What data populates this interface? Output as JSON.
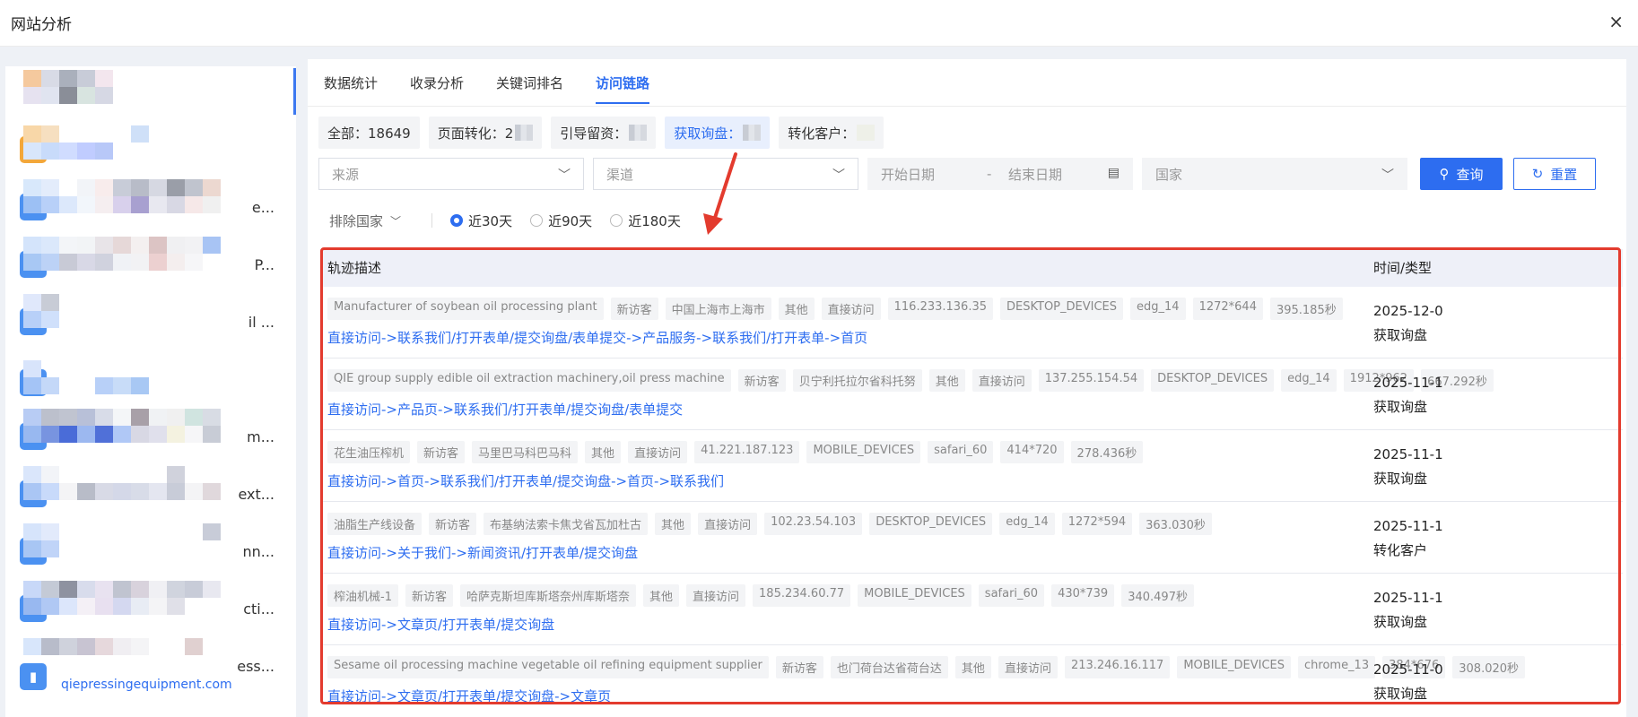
{
  "window": {
    "title": "网站分析",
    "close_label": "×"
  },
  "sidebar": {
    "sites": [
      {
        "name": ""
      },
      {
        "name": ""
      },
      {
        "name": "e..."
      },
      {
        "name": "P..."
      },
      {
        "name": "il ..."
      },
      {
        "name": ""
      },
      {
        "name": "m..."
      },
      {
        "name": "ext..."
      },
      {
        "name": "nn..."
      },
      {
        "name": "cti..."
      },
      {
        "name": "ess..."
      }
    ],
    "domain": "qiepressingequipment.com"
  },
  "tabs": [
    {
      "label": "数据统计"
    },
    {
      "label": "收录分析"
    },
    {
      "label": "关键词排名"
    },
    {
      "label": "访问链路"
    }
  ],
  "counts": {
    "all": "全部：18649",
    "page_convert": "页面转化：2",
    "guide_stay": "引导留资：",
    "inquiry": "获取询盘：",
    "convert_customer": "转化客户："
  },
  "filters": {
    "source": "来源",
    "channel": "渠道",
    "start_date": "开始日期",
    "date_sep": "-",
    "end_date": "结束日期",
    "country": "国家",
    "query_label": "查询",
    "reset_label": "重置"
  },
  "options": {
    "exclude_country": "排除国家",
    "ranges": [
      "近30天",
      "近90天",
      "近180天"
    ],
    "selected_range": "近30天"
  },
  "table": {
    "headers": {
      "desc": "轨迹描述",
      "time_type": "时间/类型"
    },
    "rows": [
      {
        "tags": [
          "Manufacturer of soybean oil processing plant",
          "新访客",
          "中国上海市上海市",
          "其他",
          "直接访问",
          "116.233.136.35",
          "DESKTOP_DEVICES",
          "edg_14",
          "1272*644",
          "395.185秒"
        ],
        "path": "直接访问->联系我们/打开表单/提交询盘/表单提交->产品服务->联系我们/打开表单->首页",
        "time": "2025-12-0",
        "type": "获取询盘"
      },
      {
        "tags": [
          "QIE group supply edible oil extraction machinery,oil press machine",
          "新访客",
          "贝宁利托拉尔省科托努",
          "其他",
          "直接访问",
          "137.255.154.54",
          "DESKTOP_DEVICES",
          "edg_14",
          "1912*962",
          "667.292秒"
        ],
        "path": "直接访问->产品页->联系我们/打开表单/提交询盘/表单提交",
        "time": "2025-11-1",
        "type": "获取询盘"
      },
      {
        "tags": [
          "花生油压榨机",
          "新访客",
          "马里巴马科巴马科",
          "其他",
          "直接访问",
          "41.221.187.123",
          "MOBILE_DEVICES",
          "safari_60",
          "414*720",
          "278.436秒"
        ],
        "path": "直接访问->首页->联系我们/打开表单/提交询盘->首页->联系我们",
        "time": "2025-11-1",
        "type": "获取询盘"
      },
      {
        "tags": [
          "油脂生产线设备",
          "新访客",
          "布基纳法索卡焦戈省瓦加杜古",
          "其他",
          "直接访问",
          "102.23.54.103",
          "DESKTOP_DEVICES",
          "edg_14",
          "1272*594",
          "363.030秒"
        ],
        "path": "直接访问->关于我们->新闻资讯/打开表单/提交询盘",
        "time": "2025-11-1",
        "type": "转化客户"
      },
      {
        "tags": [
          "榨油机械-1",
          "新访客",
          "哈萨克斯坦库斯塔奈州库斯塔奈",
          "其他",
          "直接访问",
          "185.234.60.77",
          "MOBILE_DEVICES",
          "safari_60",
          "430*739",
          "340.497秒"
        ],
        "path": "直接访问->文章页/打开表单/提交询盘",
        "time": "2025-11-1",
        "type": "获取询盘"
      },
      {
        "tags": [
          "Sesame oil processing machine vegetable oil refining equipment supplier",
          "新访客",
          "也门荷台达省荷台达",
          "其他",
          "直接访问",
          "213.246.16.117",
          "MOBILE_DEVICES",
          "chrome_13",
          "384*676",
          "308.020秒"
        ],
        "path": "直接访问->文章页/打开表单/提交询盘->文章页",
        "time": "2025-11-0",
        "type": "获取询盘"
      }
    ]
  },
  "colors": {
    "accent": "#2d6df0",
    "highlight": "#e33b2e"
  }
}
